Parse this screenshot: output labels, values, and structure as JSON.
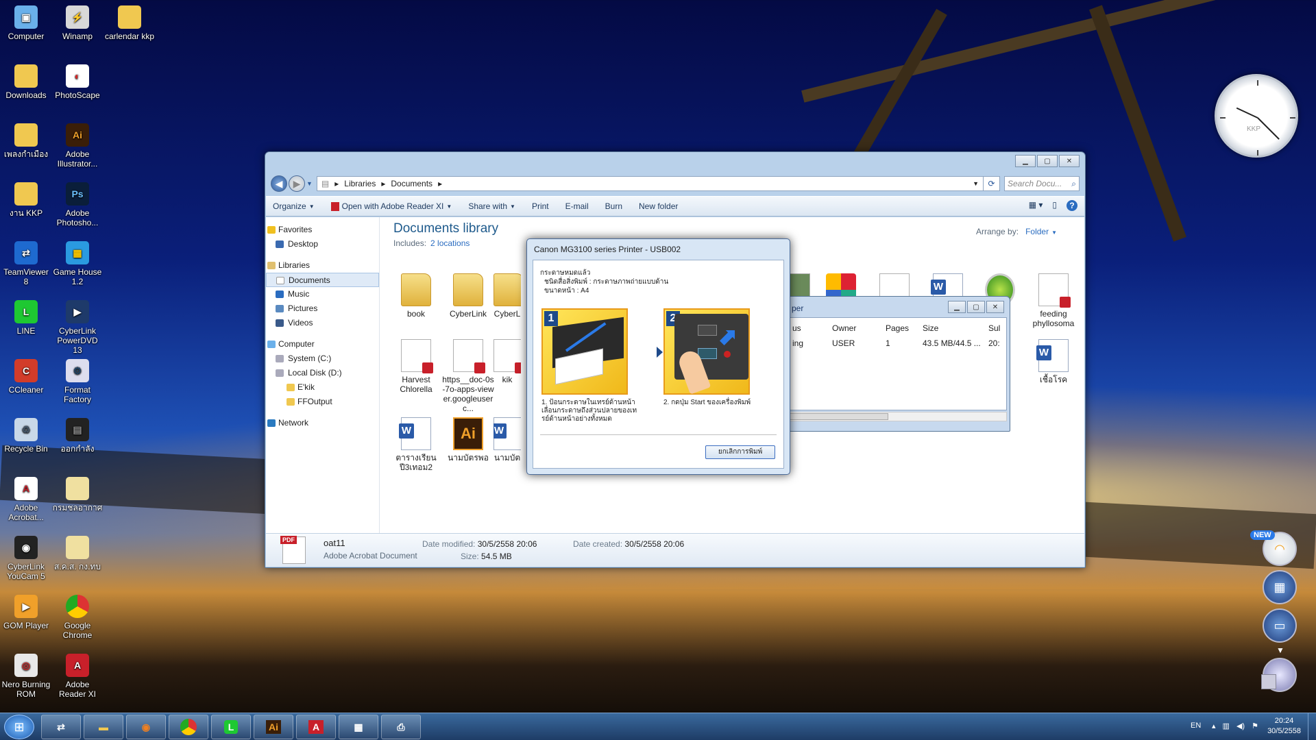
{
  "desktop": {
    "icons_col1": [
      "Computer",
      "Downloads",
      "เพลงกำเมือง",
      "งาน KKP",
      "TeamViewer 8",
      "LINE",
      "CCleaner",
      "Recycle Bin",
      "Adobe Acrobat...",
      "CyberLink YouCam 5",
      "GOM Player",
      "Nero Burning ROM"
    ],
    "icons_col2": [
      "Winamp",
      "PhotoScape",
      "Adobe Illustrator...",
      "Adobe Photosho...",
      "Game House 1.2",
      "CyberLink PowerDVD 13",
      "Format Factory",
      "ออกกำลัง",
      "กรมชลอากาศ",
      "ส.ค.ส. กง.ทบ",
      "Google Chrome",
      "Adobe Reader XI"
    ],
    "icons_col3": [
      "carlendar kkp"
    ]
  },
  "explorer": {
    "path": [
      "Libraries",
      "Documents"
    ],
    "search_placeholder": "Search Docu...",
    "toolbar": [
      "Organize",
      "Open with Adobe Reader XI",
      "Share with",
      "Print",
      "E-mail",
      "Burn",
      "New folder"
    ],
    "nav": {
      "favorites": "Favorites",
      "desktop": "Desktop",
      "libraries": "Libraries",
      "documents": "Documents",
      "music": "Music",
      "pictures": "Pictures",
      "videos": "Videos",
      "computer": "Computer",
      "system_c": "System  (C:)",
      "local_d": "Local Disk (D:)",
      "ekik": "E'kik",
      "ffoutput": "FFOutput",
      "network": "Network"
    },
    "library_title": "Documents library",
    "includes_label": "Includes:",
    "includes_link": "2 locations",
    "arrange_label": "Arrange by:",
    "arrange_value": "Folder",
    "files": [
      "book",
      "CyberLink",
      "CyberL",
      "Harvest Chlorella",
      "https__doc-0s-7o-apps-viewer.googleuserc...",
      "kik",
      "ตารางเรียน ปี3เทอม2",
      "นามบัตรพอ",
      "นามบัต",
      "feeding phyllosoma",
      "เชื้อโรค"
    ],
    "details": {
      "name": "oat11",
      "type": "Adobe Acrobat Document",
      "modified_label": "Date modified:",
      "modified": "30/5/2558 20:06",
      "created_label": "Date created:",
      "created": "30/5/2558 20:06",
      "size_label": "Size:",
      "size": "54.5 MB",
      "icon_badge": "PDF"
    }
  },
  "print_queue": {
    "title_fragment": "per",
    "headers": [
      "us",
      "Owner",
      "Pages",
      "Size",
      "Sul"
    ],
    "row": [
      "ing",
      "USER",
      "1",
      "43.5 MB/44.5 ...",
      "20:"
    ]
  },
  "canon_dialog": {
    "title": "Canon MG3100 series Printer - USB002",
    "message_line1": "กระดาษหมดแล้ว",
    "message_line2": "ชนิดสื่อสิ่งพิมพ์ : กระดาษภาพถ่ายแบบด้าน",
    "message_line3": "ขนาดหน้า : A4",
    "step1_num": "1",
    "step2_num": "2",
    "step1_caption": "1.  ป้อนกระดาษในเทรย์ด้านหน้า เลื่อนกระดาษถึงส่วนปลายของเทรย์ด้านหน้าอย่างทั้งหมด",
    "step2_caption": "2.  กดปุ่ม Start ของเครื่องพิมพ์",
    "cancel_label": "ยกเลิกการพิมพ์"
  },
  "clock": {
    "label": "KKP"
  },
  "gadgets": {
    "new_badge": "NEW"
  },
  "taskbar": {
    "language": "EN",
    "time": "20:24",
    "date": "30/5/2558",
    "apps": [
      "teamviewer",
      "explorer",
      "firefox",
      "chrome",
      "line",
      "illustrator",
      "acrobat",
      "control-panel",
      "printer"
    ]
  }
}
